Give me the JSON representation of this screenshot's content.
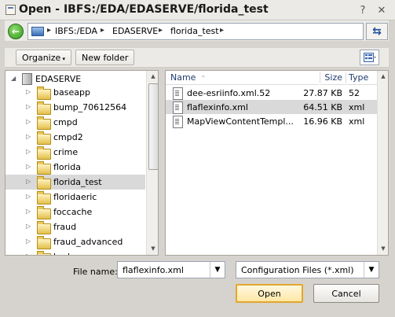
{
  "window": {
    "title": "Open - IBFS:/EDA/EDASERVE/florida_test"
  },
  "address_bar": {
    "crumbs": [
      "IBFS:/EDA",
      "EDASERVE",
      "florida_test"
    ],
    "back_icon": "back-arrow-icon",
    "refresh_icon": "refresh-icon"
  },
  "toolbar": {
    "organize_label": "Organize",
    "new_folder_label": "New folder",
    "view_icon": "view-mode-icon"
  },
  "tree": {
    "root": "EDASERVE",
    "items": [
      {
        "label": "baseapp",
        "selected": false
      },
      {
        "label": "bump_70612564",
        "selected": false
      },
      {
        "label": "cmpd",
        "selected": false
      },
      {
        "label": "cmpd2",
        "selected": false
      },
      {
        "label": "crime",
        "selected": false
      },
      {
        "label": "florida",
        "selected": false
      },
      {
        "label": "florida_test",
        "selected": true
      },
      {
        "label": "floridaeric",
        "selected": false
      },
      {
        "label": "foccache",
        "selected": false
      },
      {
        "label": "fraud",
        "selected": false
      },
      {
        "label": "fraud_advanced",
        "selected": false
      },
      {
        "label": "hnd",
        "selected": false
      }
    ]
  },
  "file_list": {
    "columns": {
      "name": "Name",
      "size": "Size",
      "type": "Type"
    },
    "files": [
      {
        "name": "dee-esriinfo.xml.52",
        "size": "27.87 KB",
        "type": "52",
        "selected": false
      },
      {
        "name": "flaflexinfo.xml",
        "size": "64.51 KB",
        "type": "xml",
        "selected": true
      },
      {
        "name": "MapViewContentTempl...",
        "size": "16.96 KB",
        "type": "xml",
        "selected": false
      }
    ]
  },
  "bottom": {
    "file_name_label": "File name:",
    "file_name_value": "flaflexinfo.xml",
    "filter_value": "Configuration Files (*.xml)",
    "open_label": "Open",
    "cancel_label": "Cancel"
  },
  "colors": {
    "accent_button_border": "#e2a72c",
    "selection": "#d9d9d9"
  }
}
